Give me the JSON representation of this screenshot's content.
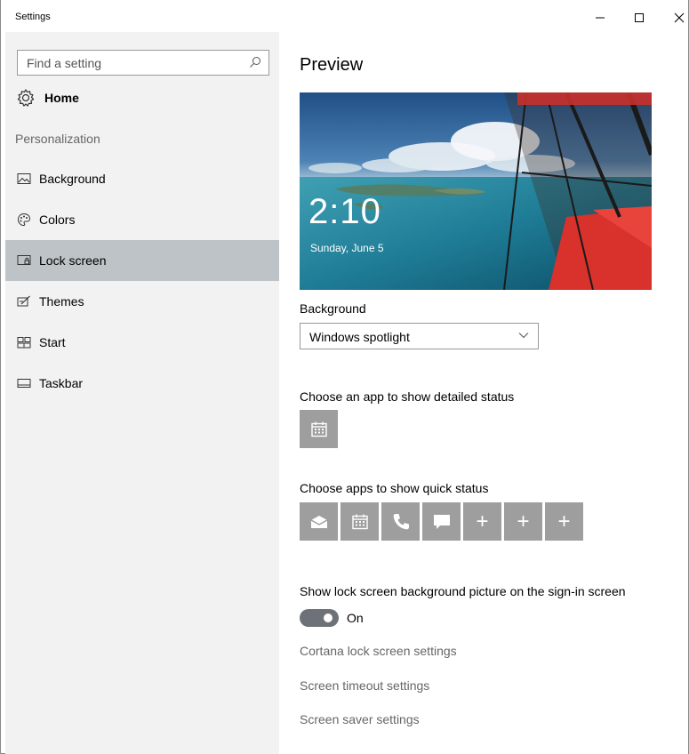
{
  "window": {
    "title": "Settings"
  },
  "sidebar": {
    "search_placeholder": "Find a setting",
    "home_label": "Home",
    "section_label": "Personalization",
    "items": [
      {
        "label": "Background",
        "icon": "picture-icon"
      },
      {
        "label": "Colors",
        "icon": "palette-icon"
      },
      {
        "label": "Lock screen",
        "icon": "lock-screen-icon",
        "active": true
      },
      {
        "label": "Themes",
        "icon": "themes-icon"
      },
      {
        "label": "Start",
        "icon": "start-icon"
      },
      {
        "label": "Taskbar",
        "icon": "taskbar-icon"
      }
    ]
  },
  "main": {
    "heading": "Preview",
    "preview": {
      "time": "2:10",
      "date": "Sunday, June 5"
    },
    "background_label": "Background",
    "background_value": "Windows spotlight",
    "detailed_status_label": "Choose an app to show detailed status",
    "quick_status_label": "Choose apps to show quick status",
    "quick_status_tiles": [
      "mail-icon",
      "calendar-icon",
      "phone-icon",
      "message-icon",
      "add-icon",
      "add-icon",
      "add-icon"
    ],
    "add_symbol": "+",
    "signin_label": "Show lock screen background picture on the sign-in screen",
    "signin_toggle_state": "On",
    "links": {
      "cortana": "Cortana lock screen settings",
      "timeout": "Screen timeout settings",
      "saver": "Screen saver settings"
    }
  },
  "colors": {
    "sidebar_bg": "#f2f2f2",
    "active_item_bg": "#bdc3c6",
    "tile_bg": "#9e9e9e",
    "toggle_on": "#6d7278",
    "link_text": "#666666"
  }
}
